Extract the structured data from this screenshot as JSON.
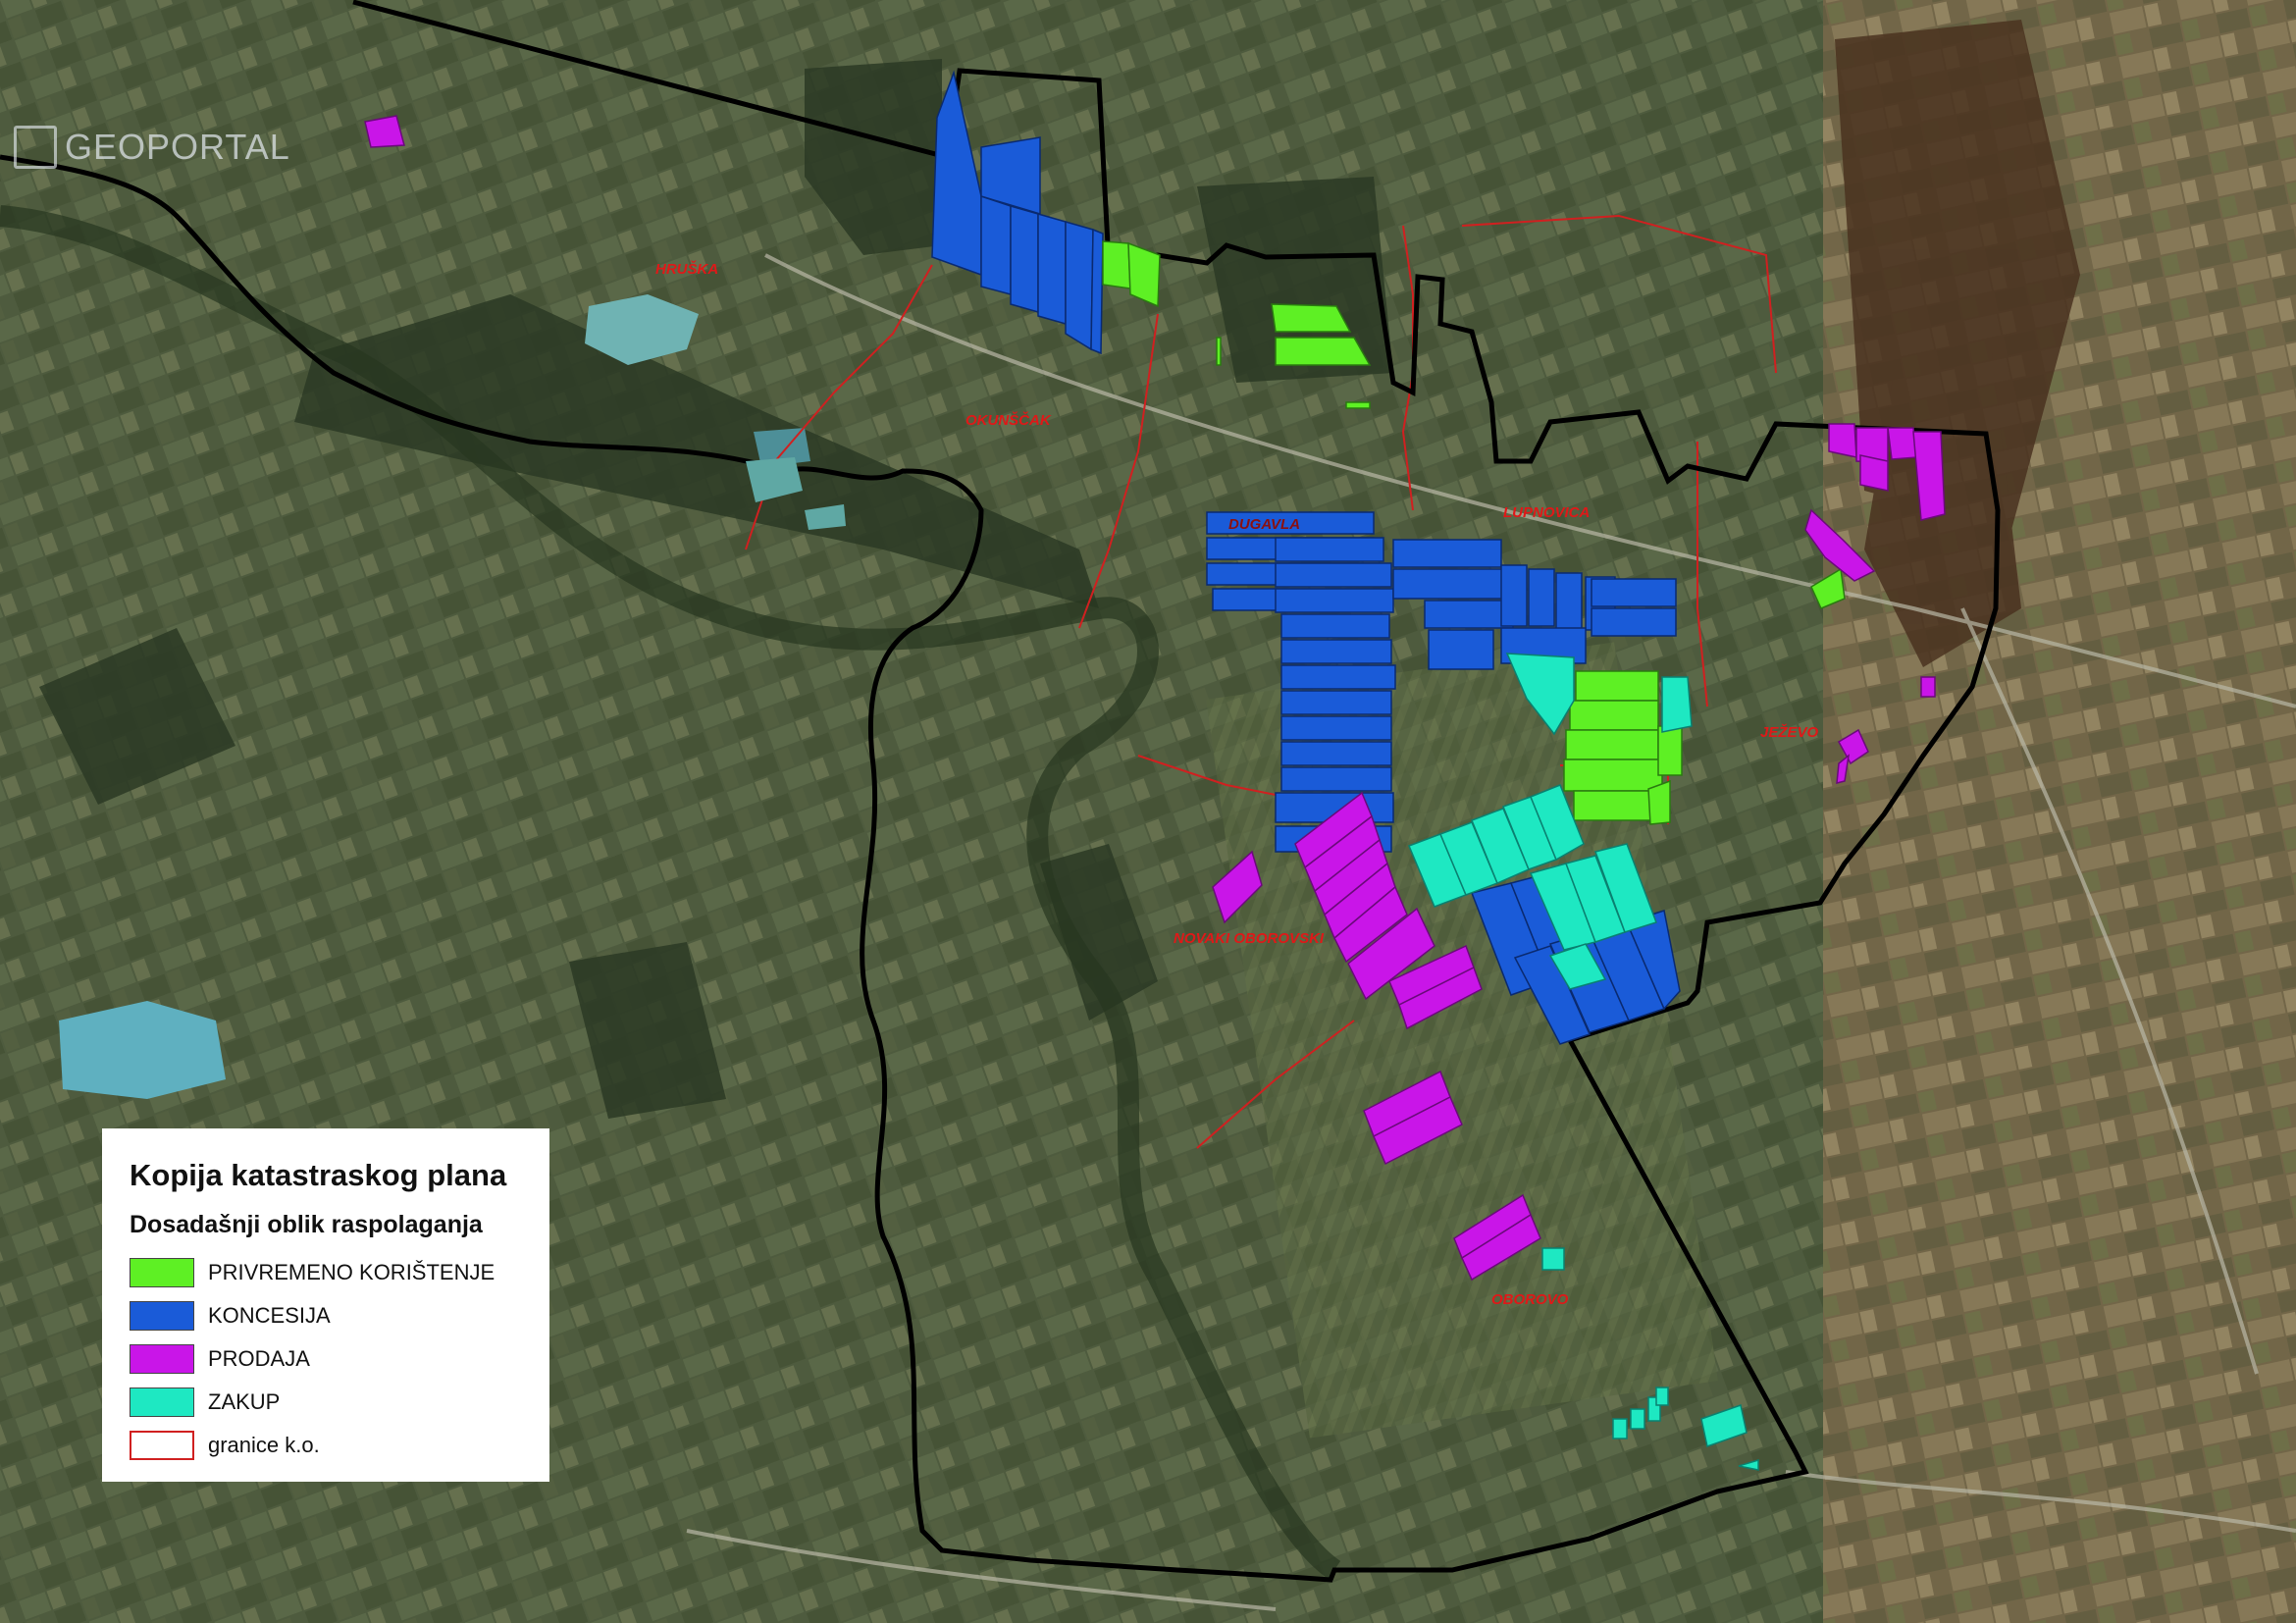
{
  "watermark": "GEOPORTAL",
  "places": [
    "HRUŠKA",
    "OKUNŠČAK",
    "LUPNOVICA",
    "JEŽEVO",
    "DUGAVLA",
    "NOVAKI OBOROVSKI",
    "OBOROVO"
  ],
  "legend": {
    "title": "Kopija katastraskog plana",
    "subtitle": "Dosadašnji oblik raspolaganja",
    "items": [
      {
        "label": "PRIVREMENO KORIŠTENJE",
        "color": "#5ef024",
        "icon": "solid-swatch"
      },
      {
        "label": "KONCESIJA",
        "color": "#1a5bd8",
        "icon": "solid-swatch"
      },
      {
        "label": "PRODAJA",
        "color": "#c915e8",
        "icon": "solid-swatch"
      },
      {
        "label": "ZAKUP",
        "color": "#1ee8c2",
        "icon": "solid-swatch"
      },
      {
        "label": "granice k.o.",
        "color": "#d02020",
        "icon": "outline-swatch"
      }
    ]
  },
  "colors": {
    "privremeno": "#5ef024",
    "koncesija": "#1a5bd8",
    "prodaja": "#c915e8",
    "zakup": "#1ee8c2",
    "granice": "#d02020",
    "boundary": "#000000"
  }
}
